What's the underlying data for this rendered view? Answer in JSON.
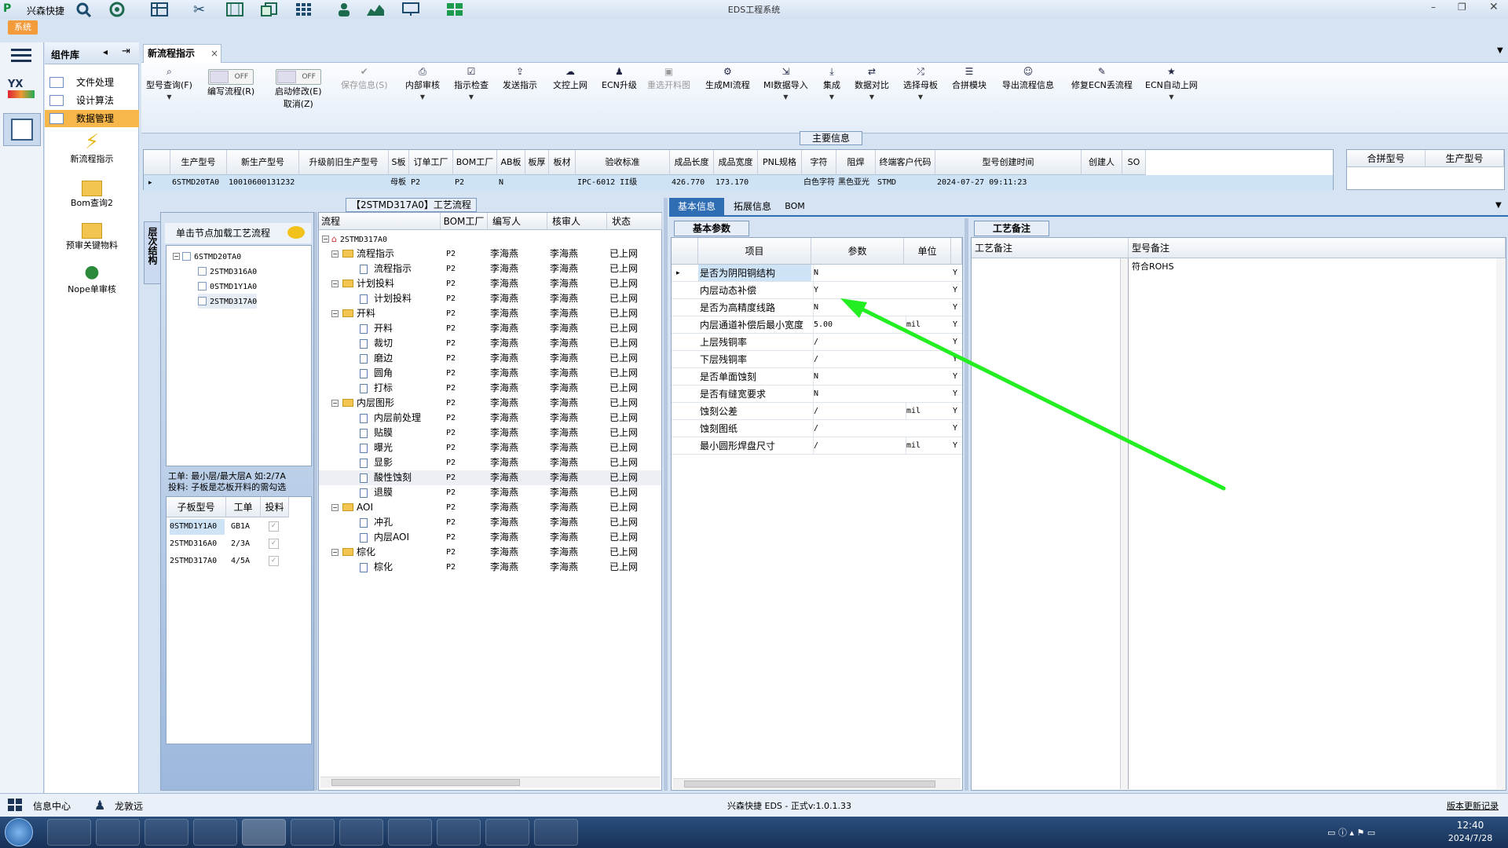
{
  "app": {
    "logo": "兴森快捷",
    "title": "EDS工程系统",
    "system_menu": "系统"
  },
  "nav": {
    "header": "组件库",
    "items": [
      "文件处理",
      "设计算法",
      "数据管理"
    ],
    "big_items": [
      "新流程指示",
      "Bom查询2",
      "预审关键物料",
      "Nope单审核"
    ]
  },
  "tab": {
    "label": "新流程指示",
    "close": "×"
  },
  "ribbon": {
    "buttons": [
      {
        "label": "型号查询(F)",
        "icon": "search-icon",
        "dropdown": true
      },
      {
        "label": "编写流程(R)",
        "icon": "toggle-off",
        "toggle": "OFF"
      },
      {
        "label": "启动修改(E)",
        "label2": "取消(Z)",
        "icon": "toggle-off",
        "toggle": "OFF"
      },
      {
        "label": "保存信息(S)",
        "icon": "check-icon",
        "disabled": true
      },
      {
        "label": "内部审核",
        "icon": "print-icon",
        "dropdown": true
      },
      {
        "label": "指示检查",
        "icon": "check-box-icon",
        "dropdown": true
      },
      {
        "label": "发送指示",
        "icon": "upload-icon"
      },
      {
        "label": "文控上网",
        "icon": "cloud-upload-icon"
      },
      {
        "label": "ECN升级",
        "icon": "person-icon"
      },
      {
        "label": "重选开料图",
        "icon": "image-icon",
        "disabled": true
      },
      {
        "label": "生成MI流程",
        "icon": "gear-icon"
      },
      {
        "label": "MI数据导入",
        "icon": "import-icon",
        "dropdown": true
      },
      {
        "label": "集成",
        "icon": "download-icon",
        "dropdown": true
      },
      {
        "label": "数据对比",
        "icon": "compare-icon",
        "dropdown": true
      },
      {
        "label": "选择母板",
        "icon": "shuffle-icon",
        "dropdown": true
      },
      {
        "label": "合拼模块",
        "icon": "list-icon"
      },
      {
        "label": "导出流程信息",
        "icon": "smile-icon"
      },
      {
        "label": "修复ECN丢流程",
        "icon": "wrench-icon"
      },
      {
        "label": "ECN自动上网",
        "icon": "star-icon",
        "dropdown": true
      }
    ]
  },
  "main_info": {
    "title": "主要信息",
    "columns": [
      "生产型号",
      "新生产型号",
      "升级前旧生产型号",
      "S板",
      "订单工厂",
      "BOM工厂",
      "AB板",
      "板厚",
      "板材",
      "验收标准",
      "成品长度",
      "成品宽度",
      "PNL规格",
      "字符",
      "阻焊",
      "终端客户代码",
      "型号创建时间",
      "创建人",
      "SO"
    ],
    "row": [
      "6STMD20TA0",
      "10010600131232",
      "",
      "母板",
      "P2",
      "P2",
      "N",
      "",
      "",
      "IPC-6012 II级",
      "426.770",
      "173.170",
      "",
      "白色字符",
      "黑色亚光",
      "STMD",
      "2024-07-27 09:11:23",
      "",
      ""
    ],
    "side_columns": [
      "合拼型号",
      "生产型号"
    ]
  },
  "left_panel": {
    "vertical_tab": "层次结构",
    "hint": "单击节点加载工艺流程",
    "tree_root": "6STMD20TA0",
    "tree_children": [
      "2STMD316A0",
      "0STMD1Y1A0",
      "2STMD317A0"
    ],
    "note_line1": "工单: 最小层/最大层A 如:2/7A",
    "note_line2": "投料: 子板是芯板开料的需勾选",
    "sub_columns": [
      "子板型号",
      "工单",
      "投料"
    ],
    "sub_rows": [
      {
        "model": "0STMD1Y1A0",
        "order": "GB1A",
        "feed": "✓"
      },
      {
        "model": "2STMD316A0",
        "order": "2/3A",
        "feed": "✓"
      },
      {
        "model": "2STMD317A0",
        "order": "4/5A",
        "feed": "✓"
      }
    ]
  },
  "process": {
    "title": "【2STMD317A0】工艺流程",
    "columns": [
      "流程",
      "BOM工厂",
      "编写人",
      "核审人",
      "状态"
    ],
    "root": "2STMD317A0",
    "rows": [
      {
        "name": "流程指示",
        "type": "folder",
        "level": 1,
        "bom": "P2",
        "writer": "李海燕",
        "reviewer": "李海燕",
        "status": "已上网"
      },
      {
        "name": "流程指示",
        "type": "doc",
        "level": 2,
        "bom": "P2",
        "writer": "李海燕",
        "reviewer": "李海燕",
        "status": "已上网"
      },
      {
        "name": "计划投料",
        "type": "folder",
        "level": 1,
        "bom": "P2",
        "writer": "李海燕",
        "reviewer": "李海燕",
        "status": "已上网"
      },
      {
        "name": "计划投料",
        "type": "doc",
        "level": 2,
        "bom": "P2",
        "writer": "李海燕",
        "reviewer": "李海燕",
        "status": "已上网"
      },
      {
        "name": "开料",
        "type": "folder",
        "level": 1,
        "bom": "P2",
        "writer": "李海燕",
        "reviewer": "李海燕",
        "status": "已上网"
      },
      {
        "name": "开料",
        "type": "doc",
        "level": 2,
        "bom": "P2",
        "writer": "李海燕",
        "reviewer": "李海燕",
        "status": "已上网"
      },
      {
        "name": "裁切",
        "type": "doc",
        "level": 2,
        "bom": "P2",
        "writer": "李海燕",
        "reviewer": "李海燕",
        "status": "已上网"
      },
      {
        "name": "磨边",
        "type": "doc",
        "level": 2,
        "bom": "P2",
        "writer": "李海燕",
        "reviewer": "李海燕",
        "status": "已上网"
      },
      {
        "name": "圆角",
        "type": "doc",
        "level": 2,
        "bom": "P2",
        "writer": "李海燕",
        "reviewer": "李海燕",
        "status": "已上网"
      },
      {
        "name": "打标",
        "type": "doc",
        "level": 2,
        "bom": "P2",
        "writer": "李海燕",
        "reviewer": "李海燕",
        "status": "已上网"
      },
      {
        "name": "内层图形",
        "type": "folder",
        "level": 1,
        "bom": "P2",
        "writer": "李海燕",
        "reviewer": "李海燕",
        "status": "已上网"
      },
      {
        "name": "内层前处理",
        "type": "doc",
        "level": 2,
        "bom": "P2",
        "writer": "李海燕",
        "reviewer": "李海燕",
        "status": "已上网"
      },
      {
        "name": "贴膜",
        "type": "doc",
        "level": 2,
        "bom": "P2",
        "writer": "李海燕",
        "reviewer": "李海燕",
        "status": "已上网"
      },
      {
        "name": "曝光",
        "type": "doc",
        "level": 2,
        "bom": "P2",
        "writer": "李海燕",
        "reviewer": "李海燕",
        "status": "已上网"
      },
      {
        "name": "显影",
        "type": "doc",
        "level": 2,
        "bom": "P2",
        "writer": "李海燕",
        "reviewer": "李海燕",
        "status": "已上网"
      },
      {
        "name": "酸性蚀刻",
        "type": "doc",
        "level": 2,
        "bom": "P2",
        "writer": "李海燕",
        "reviewer": "李海燕",
        "status": "已上网"
      },
      {
        "name": "退膜",
        "type": "doc",
        "level": 2,
        "bom": "P2",
        "writer": "李海燕",
        "reviewer": "李海燕",
        "status": "已上网"
      },
      {
        "name": "AOI",
        "type": "folder",
        "level": 1,
        "bom": "P2",
        "writer": "李海燕",
        "reviewer": "李海燕",
        "status": "已上网"
      },
      {
        "name": "冲孔",
        "type": "doc",
        "level": 2,
        "bom": "P2",
        "writer": "李海燕",
        "reviewer": "李海燕",
        "status": "已上网"
      },
      {
        "name": "内层AOI",
        "type": "doc",
        "level": 2,
        "bom": "P2",
        "writer": "李海燕",
        "reviewer": "李海燕",
        "status": "已上网"
      },
      {
        "name": "棕化",
        "type": "folder",
        "level": 1,
        "bom": "P2",
        "writer": "李海燕",
        "reviewer": "李海燕",
        "status": "已上网"
      },
      {
        "name": "棕化",
        "type": "doc",
        "level": 2,
        "bom": "P2",
        "writer": "李海燕",
        "reviewer": "李海燕",
        "status": "已上网"
      }
    ]
  },
  "detail_tabs": [
    "基本信息",
    "拓展信息",
    "BOM"
  ],
  "basic_params": {
    "title": "基本参数",
    "columns": [
      "项目",
      "参数",
      "单位"
    ],
    "rows": [
      {
        "item": "是否为阴阳铜结构",
        "value": "N",
        "unit": "",
        "flag": "Y"
      },
      {
        "item": "内层动态补偿",
        "value": "Y",
        "unit": "",
        "flag": "Y"
      },
      {
        "item": "是否为高精度线路",
        "value": "N",
        "unit": "",
        "flag": "Y"
      },
      {
        "item": "内层通道补偿后最小宽度",
        "value": "5.00",
        "unit": "mil",
        "flag": "Y"
      },
      {
        "item": "上层残铜率",
        "value": "/",
        "unit": "",
        "flag": "Y"
      },
      {
        "item": "下层残铜率",
        "value": "/",
        "unit": "",
        "flag": "Y"
      },
      {
        "item": "是否单面蚀刻",
        "value": "N",
        "unit": "",
        "flag": "Y"
      },
      {
        "item": "是否有缝宽要求",
        "value": "N",
        "unit": "",
        "flag": "Y"
      },
      {
        "item": "蚀刻公差",
        "value": "/",
        "unit": "mil",
        "flag": "Y"
      },
      {
        "item": "蚀刻图纸",
        "value": "/",
        "unit": "",
        "flag": "Y"
      },
      {
        "item": "最小圆形焊盘尺寸",
        "value": "/",
        "unit": "mil",
        "flag": "Y"
      }
    ]
  },
  "remarks": {
    "title": "工艺备注",
    "col1": "工艺备注",
    "col2": "型号备注",
    "model_note": "符合ROHS"
  },
  "status": {
    "info_center": "信息中心",
    "user": "龙敦远",
    "version": "兴森快捷 EDS - 正式v:1.0.1.33",
    "changelog": "版本更新记录"
  },
  "clock": {
    "time": "12:40",
    "date": "2024/7/28"
  },
  "colors": {
    "annotation_arrow": "#22ee22",
    "selected_row": "#cfe3f7",
    "highlight_item": "#cfe3f7"
  }
}
